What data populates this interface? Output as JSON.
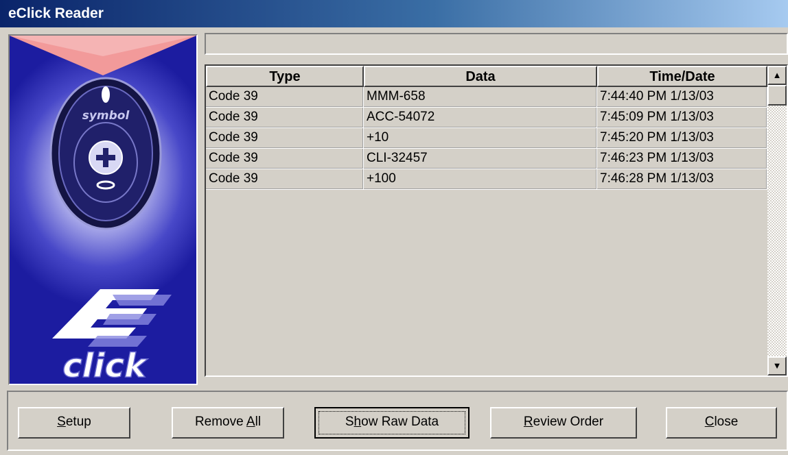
{
  "window": {
    "title": "eClick Reader"
  },
  "graphic": {
    "brand": "symbol",
    "logo_text": "click"
  },
  "table": {
    "columns": [
      "Type",
      "Data",
      "Time/Date"
    ],
    "rows": [
      [
        "Code 39",
        "MMM-658",
        "7:44:40 PM  1/13/03"
      ],
      [
        "Code 39",
        "ACC-54072",
        "7:45:09 PM  1/13/03"
      ],
      [
        "Code 39",
        "+10",
        "7:45:20 PM  1/13/03"
      ],
      [
        "Code 39",
        "CLI-32457",
        "7:46:23 PM  1/13/03"
      ],
      [
        "Code 39",
        "+100",
        "7:46:28 PM  1/13/03"
      ]
    ]
  },
  "buttons": {
    "setup": {
      "pre": "",
      "u": "S",
      "post": "etup"
    },
    "remove_all": {
      "pre": "Remove ",
      "u": "A",
      "post": "ll"
    },
    "show_raw": {
      "pre": "S",
      "u": "h",
      "post": "ow Raw Data"
    },
    "review_order": {
      "pre": "",
      "u": "R",
      "post": "eview Order"
    },
    "close": {
      "pre": "",
      "u": "C",
      "post": "lose"
    }
  },
  "colors": {
    "title_start": "#0a246a",
    "title_end": "#a6caf0",
    "face": "#d4d0c8"
  }
}
